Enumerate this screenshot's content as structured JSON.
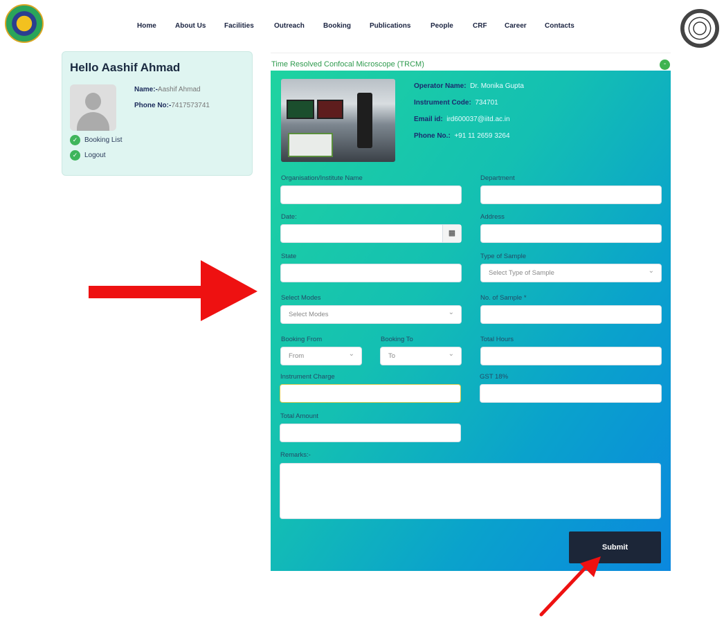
{
  "nav": [
    "Home",
    "About Us",
    "Facilities",
    "Outreach",
    "Booking",
    "Publications",
    "People",
    "CRF",
    "Career",
    "Contacts"
  ],
  "profile": {
    "greeting": "Hello Aashif Ahmad",
    "name_label": "Name:-",
    "name_value": "Aashif Ahmad",
    "phone_label": "Phone No:-",
    "phone_value": "7417573741",
    "links": [
      "Booking List",
      "Logout"
    ]
  },
  "instrument": {
    "title": "Time Resolved Confocal Microscope (TRCM)",
    "collapse_symbol": "-",
    "operator_label": "Operator Name:",
    "operator_value": "Dr. Monika Gupta",
    "code_label": "Instrument Code:",
    "code_value": "734701",
    "email_label": "Email id:",
    "email_value": "ird600037@iitd.ac.in",
    "phone_label": "Phone No.:",
    "phone_value": "+91 11 2659 3264"
  },
  "form": {
    "org_label": "Organisation/Institute Name",
    "dept_label": "Department",
    "date_label": "Date:",
    "address_label": "Address",
    "state_label": "State",
    "sample_type_label": "Type of Sample",
    "sample_type_placeholder": "Select Type of Sample",
    "modes_label": "Select Modes",
    "modes_placeholder": "Select Modes",
    "num_sample_label": "No. of Sample *",
    "from_label": "Booking From",
    "from_placeholder": "From",
    "to_label": "Booking To",
    "to_placeholder": "To",
    "hours_label": "Total Hours",
    "charge_label": "Instrument Charge",
    "gst_label": "GST 18%",
    "total_label": "Total Amount",
    "remarks_label": "Remarks:-",
    "submit_label": "Submit"
  },
  "colors": {
    "accent_green": "#3eb55b",
    "panel_start": "#1fd3a0",
    "panel_end": "#0b88de",
    "submit_bg": "#1c2638",
    "arrow": "#ee1111"
  }
}
